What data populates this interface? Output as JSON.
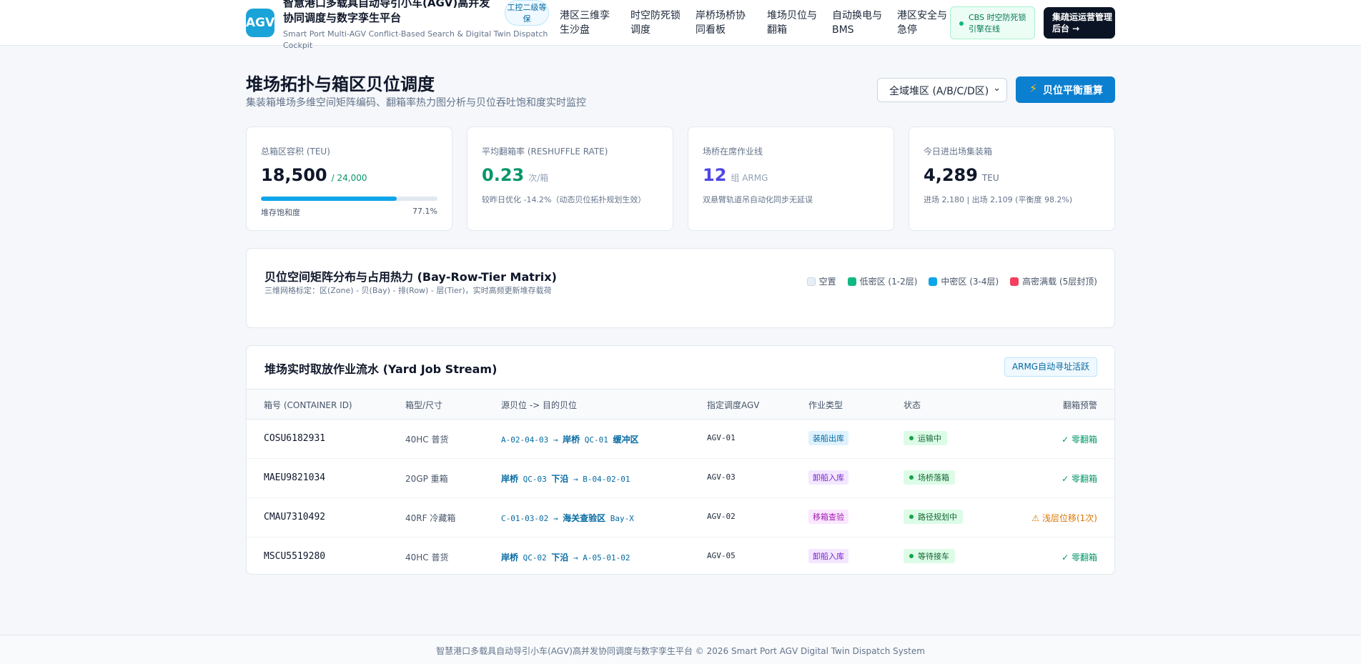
{
  "header": {
    "logo_text": "AGV",
    "title": "智慧港口多载具自动导引小车(AGV)高并发协同调度与数字孪生平台",
    "subtitle": "Smart Port Multi-AGV Conflict-Based Search & Digital Twin Dispatch Cockpit",
    "level_badge": "工控二级等保",
    "nav": [
      "港区三维孪生沙盘",
      "时空防死锁调度",
      "岸桥场桥协同看板",
      "堆场贝位与翻箱",
      "自动换电与BMS",
      "港区安全与急停"
    ],
    "cbs_status": "CBS 时空防死锁引擎在线",
    "admin_button": "集疏运运营管理后台 →",
    "accent": "#1aa3d8"
  },
  "page": {
    "title": "堆场拓扑与箱区贝位调度",
    "subtitle": "集装箱堆场多维空间矩阵编码、翻箱率热力图分析与贝位吞吐饱和度实时监控",
    "zone_select": "全域堆区 (A/B/C/D区)",
    "rebalance_button": "贝位平衡重算"
  },
  "kpis": {
    "capacity": {
      "label": "总箱区容积 (TEU)",
      "value": "18,500",
      "unit": "/ 24,000",
      "bar_label": "堆存饱和度",
      "bar_value": "77.1%",
      "fill": 0.771
    },
    "reshuffle": {
      "label": "平均翻箱率 (RESHUFFLE RATE)",
      "value": "0.23",
      "unit": "次/箱",
      "note": "较昨日优化 -14.2%（动态贝位拓扑规划生效）"
    },
    "cranes": {
      "label": "场桥在席作业线",
      "value": "12",
      "unit": "组 ARMG",
      "note": "双悬臂轨道吊自动化同步无延误"
    },
    "throughput": {
      "label": "今日进出场集装箱",
      "value": "4,289",
      "unit": "TEU",
      "note": "进场 2,180 | 出场 2,109 (平衡度 98.2%)"
    }
  },
  "matrix": {
    "title": "贝位空间矩阵分布与占用热力 (Bay-Row-Tier Matrix)",
    "subtitle": "三维网格标定：区(Zone) - 贝(Bay) - 排(Row) - 层(Tier)，实时高频更新堆存载荷",
    "legend": [
      {
        "label": "空置",
        "color": "#e8eef5"
      },
      {
        "label": "低密区 (1-2层)",
        "color": "#10b981"
      },
      {
        "label": "中密区 (3-4层)",
        "color": "#0ea5e9"
      },
      {
        "label": "高密满载 (5层封顶)",
        "color": "#f43f5e"
      }
    ]
  },
  "jobs": {
    "title": "堆场实时取放作业流水 (Yard Job Stream)",
    "badge": "ARMG自动寻址活跃",
    "columns": [
      "箱号 (CONTAINER ID)",
      "箱型/尺寸",
      "源贝位 -> 目的贝位",
      "指定调度AGV",
      "作业类型",
      "状态",
      "翻箱预警"
    ],
    "rows": [
      {
        "id": "COSU6182931",
        "type": "40HC 普货",
        "src": "A-02-04-03",
        "dst_cn": "岸桥",
        "dst_code": "QC-01",
        "dst_cn2": "缓冲区",
        "agv": "AGV-01",
        "job": "装船出库",
        "status": "运输中",
        "warn": "✓ 零翻箱"
      },
      {
        "id": "MAEU9821034",
        "type": "20GP 重箱",
        "src_cn": "岸桥",
        "src_code": "QC-03",
        "src_cn2": "下沿",
        "dst": "B-04-02-01",
        "agv": "AGV-03",
        "job": "卸船入库",
        "status": "场桥落箱",
        "warn": "✓ 零翻箱"
      },
      {
        "id": "CMAU7310492",
        "type": "40RF 冷藏箱",
        "src": "C-01-03-02",
        "dst_cn": "海关查验区",
        "dst_code": "Bay-X",
        "agv": "AGV-02",
        "job": "移箱查验",
        "status": "路径规划中",
        "warn": "⚠ 浅层位移(1次)"
      },
      {
        "id": "MSCU5519280",
        "type": "40HC 普货",
        "src_cn": "岸桥",
        "src_code": "QC-02",
        "src_cn2": "下沿",
        "dst": "A-05-01-02",
        "agv": "AGV-05",
        "job": "卸船入库",
        "status": "等待接车",
        "warn": "✓ 零翻箱"
      }
    ]
  },
  "footer": "智慧港口多载具自动导引小车(AGV)高并发协同调度与数字孪生平台 © 2026 Smart Port AGV Digital Twin Dispatch System"
}
